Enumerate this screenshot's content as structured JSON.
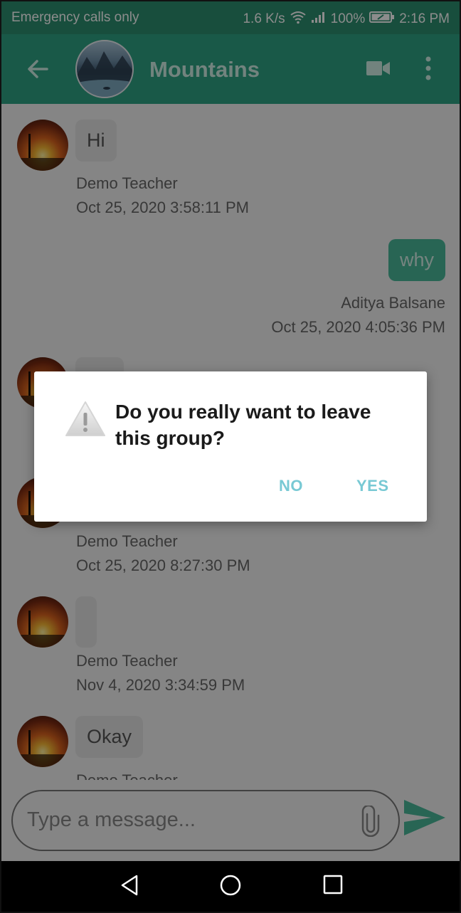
{
  "status_bar": {
    "carrier": "Emergency calls only",
    "speed": "1.6 K/s",
    "battery": "100%",
    "time": "2:16 PM"
  },
  "header": {
    "title": "Mountains"
  },
  "messages": [
    {
      "direction": "in",
      "text": "Hi",
      "sender": "Demo Teacher",
      "timestamp": "Oct 25, 2020 3:58:11 PM"
    },
    {
      "direction": "out",
      "text": "why",
      "sender": "Aditya Balsane",
      "timestamp": "Oct 25, 2020 4:05:36 PM"
    },
    {
      "direction": "in",
      "text": "",
      "sender": "Demo Teacher",
      "timestamp": "Oct 25, 2020 8:27:30 PM"
    },
    {
      "direction": "in",
      "text": "",
      "sender": "Demo Teacher",
      "timestamp": "Nov 4, 2020 3:34:59 PM"
    },
    {
      "direction": "in",
      "text": "Okay",
      "sender": "Demo Teacher",
      "timestamp": ""
    }
  ],
  "composer": {
    "placeholder": "Type a message..."
  },
  "dialog": {
    "message": "Do you really want to leave this group?",
    "no_label": "NO",
    "yes_label": "YES"
  },
  "colors": {
    "app_bar": "#2fa283",
    "status_bar": "#2c8e6f",
    "outgoing_bubble": "#49b89a",
    "dialog_button": "#78c9d4"
  },
  "icons": [
    "back-arrow-icon",
    "video-call-icon",
    "more-vert-icon",
    "attach-icon",
    "send-icon",
    "warning-icon",
    "nav-back-icon",
    "nav-home-icon",
    "nav-recents-icon"
  ]
}
